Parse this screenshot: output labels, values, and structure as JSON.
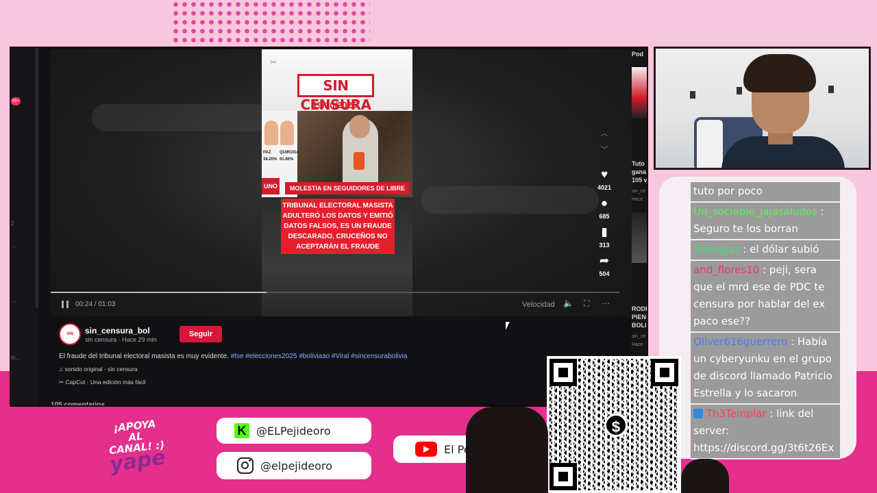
{
  "browser": {
    "left_nav": {
      "badge": "99+",
      "marks": [
        "2",
        "...",
        "...",
        "tn..."
      ]
    },
    "clip": {
      "brand": "SIN CENSURA",
      "date": "19/10/2025",
      "candidates": [
        {
          "label": "PAZ",
          "pct": "38.20%"
        },
        {
          "label": "QUIROGA",
          "pct": "61.80%"
        }
      ],
      "channel_logo": "UNO",
      "headline": "MOLESTIA EN SEGUIDORES DE LIBRE",
      "caption": "TRIBUNAL ELECTORAL MASISTA ADULTERÓ LOS DATOS Y EMITIÓ DATOS FALSOS, ES UN FRAUDE DESCARADO, CRUCEÑOS NO ACEPTARÁN EL FRAUDE"
    },
    "actions": {
      "likes": "4021",
      "comments": "685",
      "saves": "313",
      "shares": "504"
    },
    "player": {
      "time": "00:24 / 01:03",
      "speed_label": "Velocidad",
      "progress": 0.38
    },
    "right_col": {
      "top_label": "Pod",
      "item1_title": [
        "Tuto",
        "gana",
        "105 v"
      ],
      "item1_sub": [
        "sin_ce",
        "Hace"
      ],
      "item2_title": [
        "RODI",
        "PIEN",
        "BOLI"
      ],
      "item2_sub": [
        "sin_ce",
        "Hace"
      ]
    },
    "post": {
      "avatar_text": "SIN CENSURA",
      "author": "sin_censura_bol",
      "author_sub": "sin censura · Hace 29 min",
      "follow_label": "Seguir",
      "description": "El fraude del tribunal electoral masista es muy evidente.",
      "hashtags": "#tse #elecciones2025 #boliviaao #Viral #sincensurabolivia",
      "sound": "sonido original - sin censura",
      "capcut": "CapCut · Una edición más fácil",
      "comments_peek": "105 comentarios"
    }
  },
  "chat": {
    "messages": [
      {
        "user": "",
        "user_color": "#ffffff",
        "text": "tuto por poco"
      },
      {
        "user": "Un_sociable_jajasaludos",
        "user_color": "#5cf05c",
        "text": "Seguro te los borran"
      },
      {
        "user": "SrDuglaz",
        "user_color": "#3ee07a",
        "text": "el dólar subió"
      },
      {
        "user": "and_flores10",
        "user_color": "#e83a6a",
        "text": "peji, sera que el mrd ese de PDC te censura por hablar del ex paco ese??"
      },
      {
        "user": "Oliver616guerrero",
        "user_color": "#4a7cf0",
        "text": "Había un cyberyunku en el grupo de discord llamado Patricio Estrella y lo sacaron"
      },
      {
        "user": "Th3Templar",
        "user_color": "#ff3b5b",
        "text": "link del server: https://discord.gg/3t6t26Ex",
        "badge": true
      }
    ]
  },
  "socials": {
    "kick": "@ELPejideoro",
    "instagram": "@elpejideoro",
    "youtube": "El Peji De Oro"
  },
  "support": {
    "text": "¡APOYA AL CANAL! :)",
    "brand": "yape"
  },
  "qr": {
    "center_symbol": "$"
  },
  "colors": {
    "background": "#f7c8dd",
    "band": "#e42f8d",
    "tiktok_red": "#fe2c55",
    "follow_red": "#d6183b",
    "hashtag_blue": "#7fb3ff",
    "chat_bubble": "#9b9b9b"
  },
  "icons": {
    "like": "heart-icon",
    "comment": "comment-icon",
    "save": "bookmark-icon",
    "share": "share-icon",
    "volume": "volume-icon",
    "fullscreen": "fullscreen-icon",
    "more": "more-icon",
    "kick": "kick-icon",
    "instagram": "instagram-icon",
    "youtube": "youtube-icon"
  }
}
